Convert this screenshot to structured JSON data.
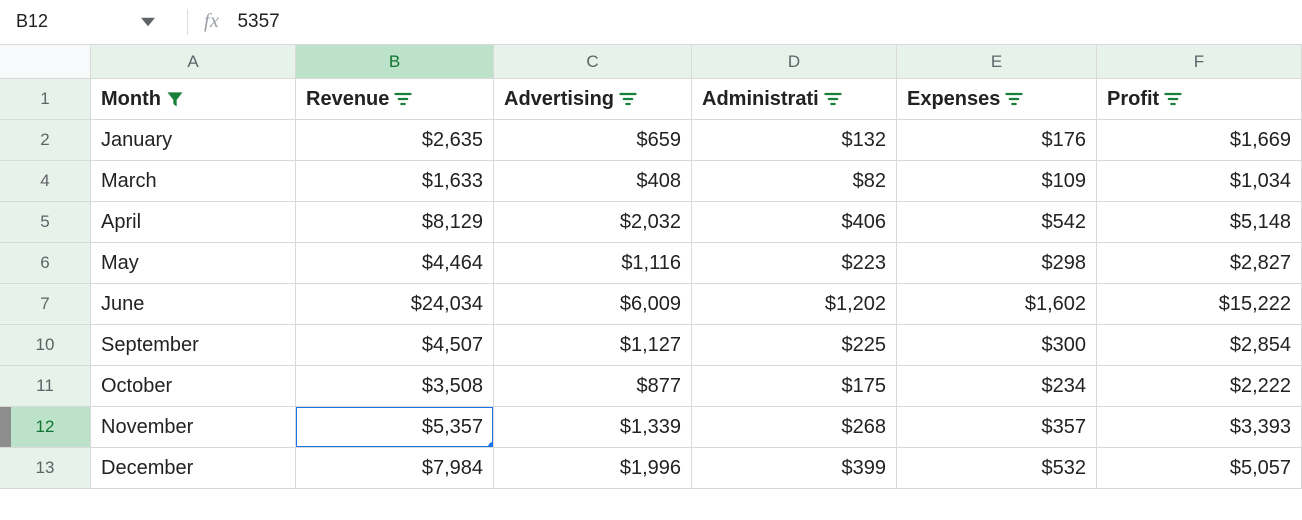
{
  "formula_bar": {
    "cell_ref": "B12",
    "fx_label": "fx",
    "formula_value": "5357"
  },
  "columns": [
    {
      "letter": "A",
      "class": "col-A",
      "selected": false
    },
    {
      "letter": "B",
      "class": "col-B",
      "selected": true
    },
    {
      "letter": "C",
      "class": "col-C",
      "selected": false
    },
    {
      "letter": "D",
      "class": "col-D",
      "selected": false
    },
    {
      "letter": "E",
      "class": "col-E",
      "selected": false
    },
    {
      "letter": "F",
      "class": "col-F",
      "selected": false
    }
  ],
  "header_row": {
    "num": "1",
    "cells": [
      {
        "label": "Month",
        "icon": "funnel"
      },
      {
        "label": "Revenue",
        "icon": "filter"
      },
      {
        "label": "Advertising",
        "icon": "filter"
      },
      {
        "label": "Administrati",
        "icon": "filter"
      },
      {
        "label": "Expenses",
        "icon": "filter"
      },
      {
        "label": "Profit",
        "icon": "filter"
      }
    ]
  },
  "data_rows": [
    {
      "num": "2",
      "selected": false,
      "cells": [
        "January",
        "$2,635",
        "$659",
        "$132",
        "$176",
        "$1,669"
      ]
    },
    {
      "num": "4",
      "selected": false,
      "cells": [
        "March",
        "$1,633",
        "$408",
        "$82",
        "$109",
        "$1,034"
      ]
    },
    {
      "num": "5",
      "selected": false,
      "cells": [
        "April",
        "$8,129",
        "$2,032",
        "$406",
        "$542",
        "$5,148"
      ]
    },
    {
      "num": "6",
      "selected": false,
      "cells": [
        "May",
        "$4,464",
        "$1,116",
        "$223",
        "$298",
        "$2,827"
      ]
    },
    {
      "num": "7",
      "selected": false,
      "cells": [
        "June",
        "$24,034",
        "$6,009",
        "$1,202",
        "$1,602",
        "$15,222"
      ]
    },
    {
      "num": "10",
      "selected": false,
      "cells": [
        "September",
        "$4,507",
        "$1,127",
        "$225",
        "$300",
        "$2,854"
      ]
    },
    {
      "num": "11",
      "selected": false,
      "cells": [
        "October",
        "$3,508",
        "$877",
        "$175",
        "$234",
        "$2,222"
      ]
    },
    {
      "num": "12",
      "selected": true,
      "cells": [
        "November",
        "$5,357",
        "$1,339",
        "$268",
        "$357",
        "$3,393"
      ]
    },
    {
      "num": "13",
      "selected": false,
      "cells": [
        "December",
        "$7,984",
        "$1,996",
        "$399",
        "$532",
        "$5,057"
      ]
    }
  ],
  "selected_cell": {
    "row": "12",
    "col_index": 1
  },
  "icons": {
    "funnel_color": "#188038",
    "filter_color": "#188038",
    "dropdown_color": "#5f6368"
  }
}
